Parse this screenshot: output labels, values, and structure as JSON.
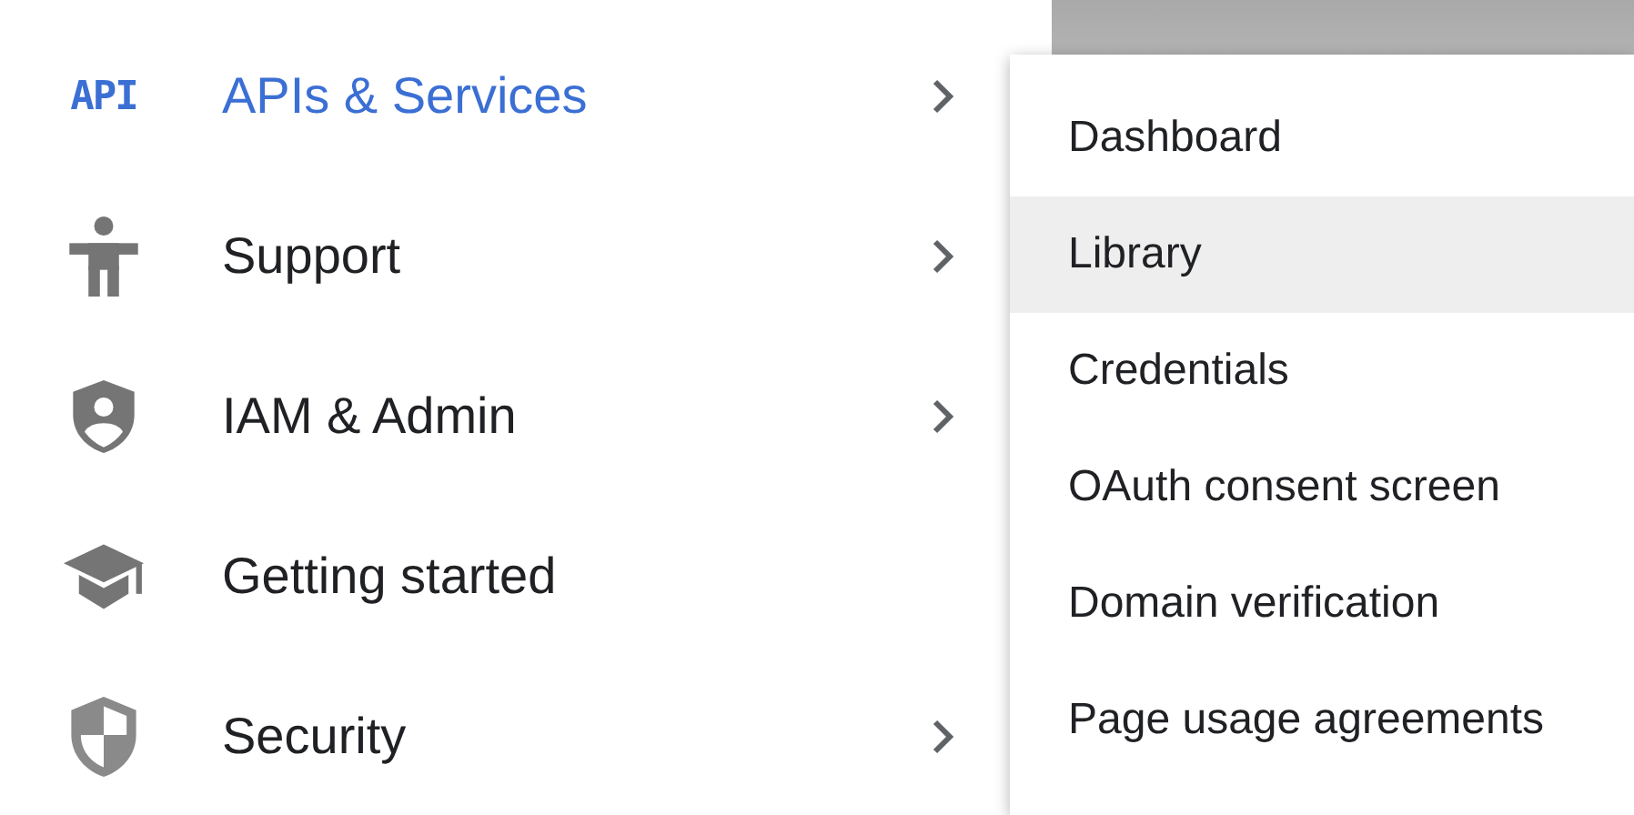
{
  "nav_items": [
    {
      "icon": "API",
      "label": "APIs & Services",
      "selected": true,
      "submenu": true,
      "kind": "text"
    },
    {
      "label": "Support",
      "selected": false,
      "submenu": true,
      "kind": "person"
    },
    {
      "label": "IAM & Admin",
      "selected": false,
      "submenu": true,
      "kind": "shield-person"
    },
    {
      "label": "Getting started",
      "selected": false,
      "submenu": false,
      "kind": "cap"
    },
    {
      "label": "Security",
      "selected": false,
      "submenu": true,
      "kind": "shield"
    }
  ],
  "submenu": [
    {
      "label": "Dashboard",
      "selected": false
    },
    {
      "label": "Library",
      "selected": true
    },
    {
      "label": "Credentials",
      "selected": false
    },
    {
      "label": "OAuth consent screen",
      "selected": false
    },
    {
      "label": "Domain verification",
      "selected": false
    },
    {
      "label": "Page usage agreements",
      "selected": false
    }
  ]
}
